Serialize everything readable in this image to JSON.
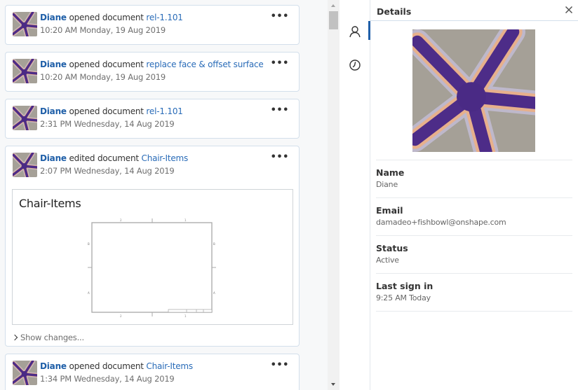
{
  "feed": {
    "items": [
      {
        "user": "Diane",
        "action": "opened document",
        "document": "rel-1.101",
        "time": "10:20 AM Monday, 19 Aug 2019"
      },
      {
        "user": "Diane",
        "action": "opened document",
        "document": "replace face & offset surface",
        "time": "10:20 AM Monday, 19 Aug 2019"
      },
      {
        "user": "Diane",
        "action": "opened document",
        "document": "rel-1.101",
        "time": "2:31 PM Wednesday, 14 Aug 2019"
      },
      {
        "user": "Diane",
        "action": "edited document",
        "document": "Chair-Items",
        "time": "2:07 PM Wednesday, 14 Aug 2019",
        "thumbnail_title": "Chair-Items",
        "show_changes": "Show changes..."
      },
      {
        "user": "Diane",
        "action": "opened document",
        "document": "Chair-Items",
        "time": "1:34 PM Wednesday, 14 Aug 2019"
      }
    ],
    "more_label": "•••",
    "drawing_labels": {
      "top_left": "2",
      "top_right": "1",
      "bottom_left": "2",
      "bottom_right": "1",
      "left_upper": "B",
      "left_lower": "A",
      "right_upper": "B",
      "right_lower": "A"
    }
  },
  "rail": {
    "items": [
      {
        "icon": "user-icon",
        "active": true
      },
      {
        "icon": "history-clock-icon",
        "active": false
      }
    ]
  },
  "details": {
    "title": "Details",
    "fields": [
      {
        "label": "Name",
        "value": "Diane"
      },
      {
        "label": "Email",
        "value": "damadeo+fishbowl@onshape.com"
      },
      {
        "label": "Status",
        "value": "Active"
      },
      {
        "label": "Last sign in",
        "value": "9:25 AM Today"
      }
    ]
  },
  "colors": {
    "accent": "#1f5fa8",
    "link": "#2a6cb8",
    "card_border": "#d3dfeb",
    "feed_bg": "#f7f8f9"
  }
}
